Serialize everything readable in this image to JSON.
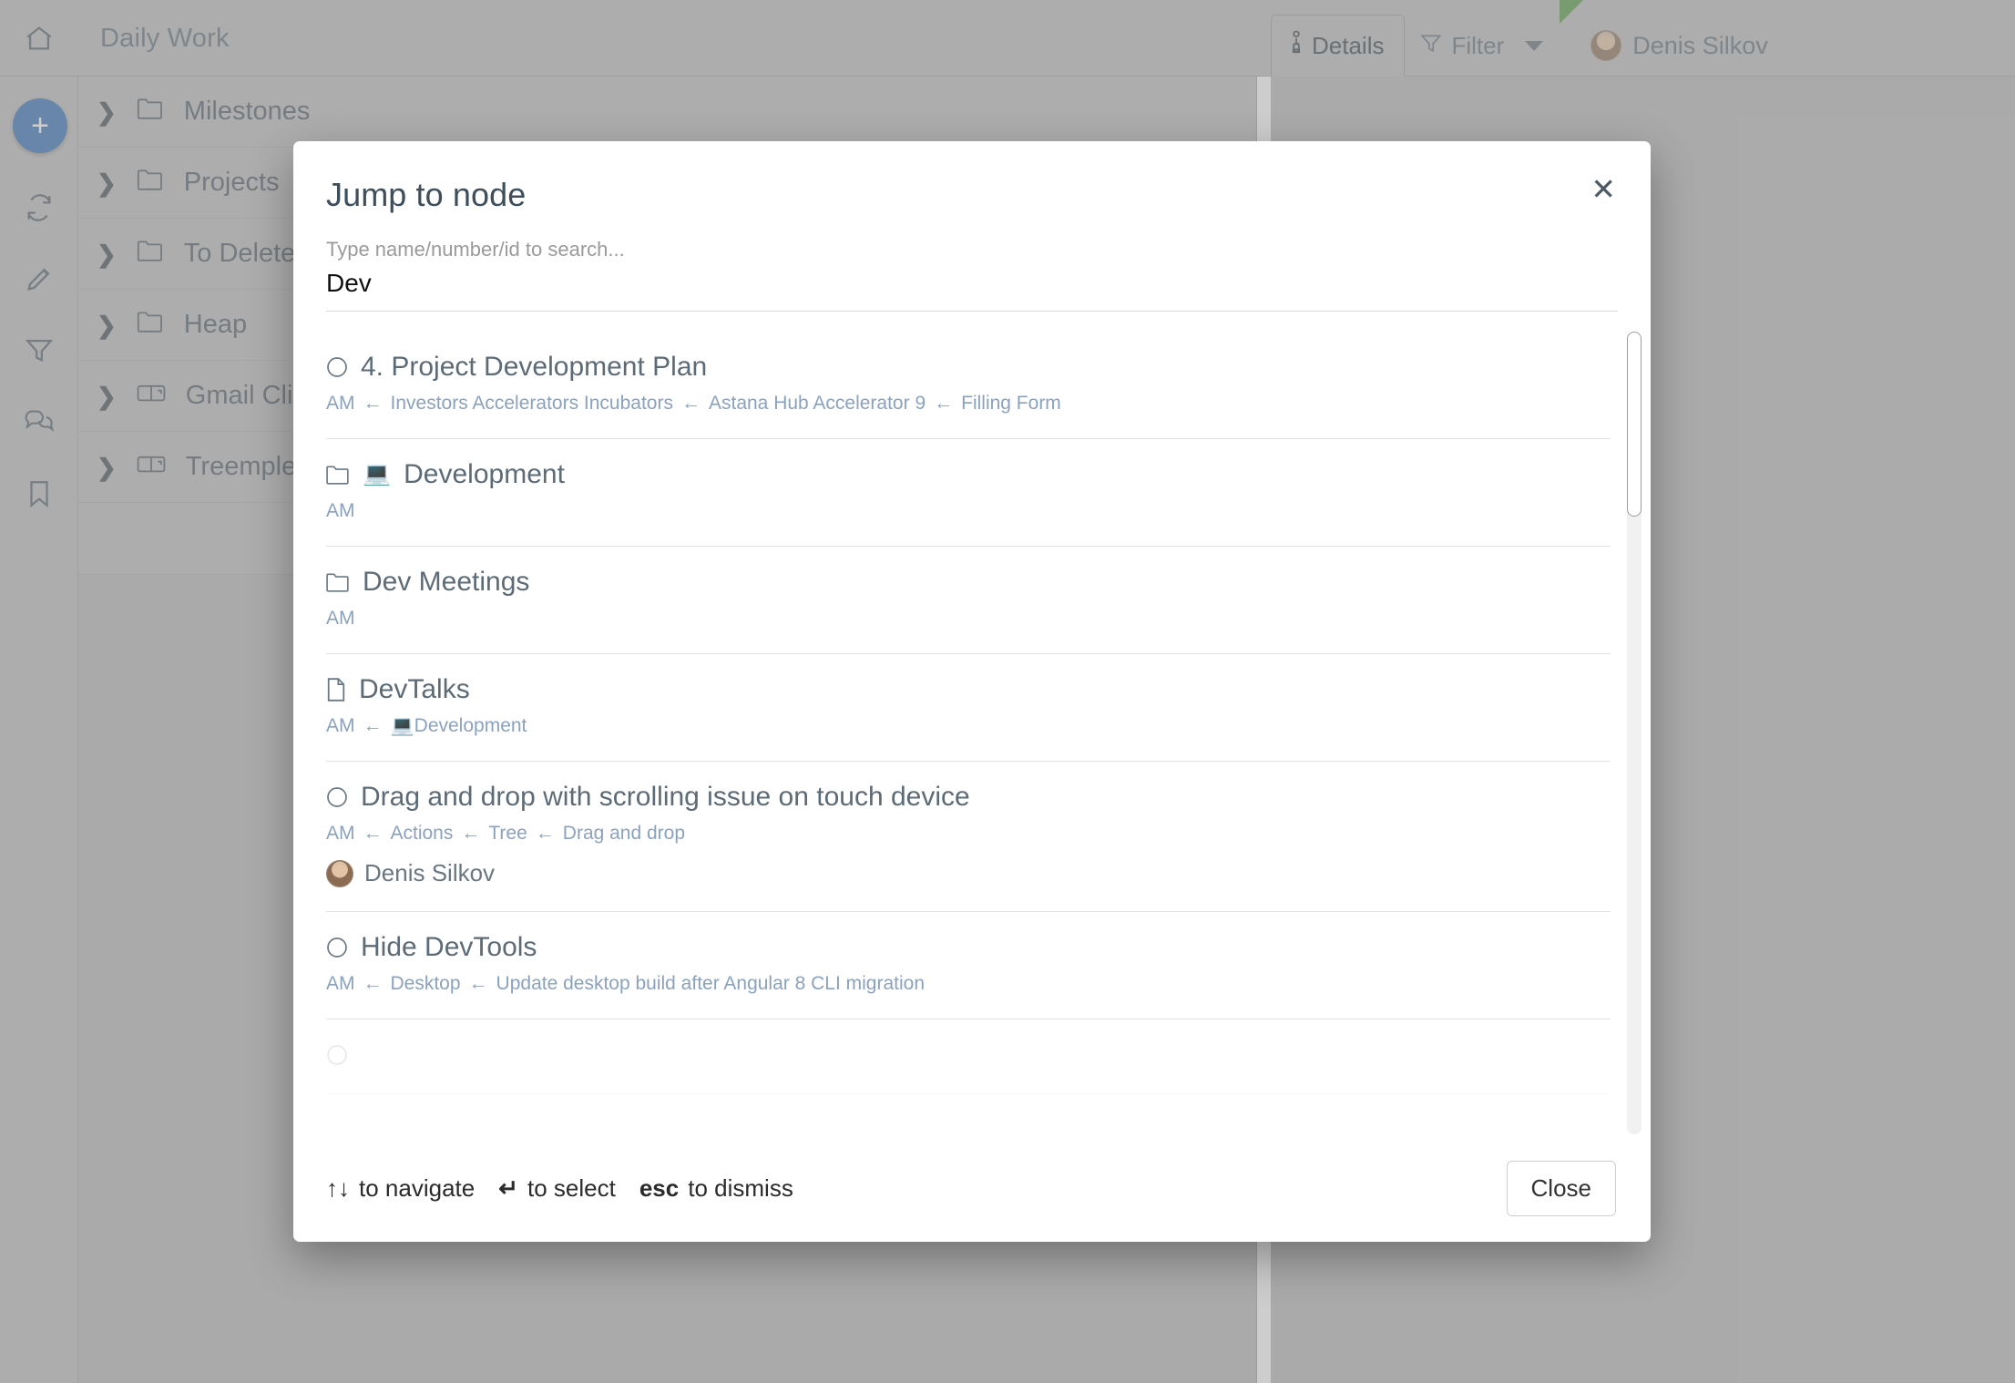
{
  "header": {
    "home_icon": "home-icon",
    "doc_title": "Daily Work",
    "details_tab": "Details",
    "details_icon": "info-person-icon",
    "filter_label": "Filter",
    "filter_icon": "funnel-icon",
    "user_name": "Denis Silkov"
  },
  "rail": {
    "add_label": "+",
    "icons": [
      "sync-icon",
      "pencil-icon",
      "funnel-icon",
      "comments-icon",
      "bookmark-icon"
    ]
  },
  "tree": {
    "items": [
      {
        "label": "Milestones",
        "icon": "folder-icon"
      },
      {
        "label": "Projects",
        "icon": "folder-icon"
      },
      {
        "label": "To Delete",
        "icon": "folder-icon"
      },
      {
        "label": "Heap",
        "icon": "folder-icon"
      },
      {
        "label": "Gmail Client",
        "icon": "mailbox-icon"
      },
      {
        "label": "Treemple G",
        "icon": "mailbox-icon"
      }
    ]
  },
  "modal": {
    "title": "Jump to node",
    "close_icon": "close-icon",
    "search_placeholder": "Type name/number/id to search...",
    "search_value": "Dev",
    "results": [
      {
        "icon": "circle-task-icon",
        "emoji": "",
        "title": "4. Project Development Plan",
        "path": [
          "AM",
          "Investors Accelerators Incubators",
          "Astana Hub Accelerator 9",
          "Filling Form"
        ],
        "assignee": ""
      },
      {
        "icon": "folder-icon",
        "emoji": "💻",
        "title": "Development",
        "path": [
          "AM"
        ],
        "assignee": ""
      },
      {
        "icon": "folder-icon",
        "emoji": "",
        "title": "Dev Meetings",
        "path": [
          "AM"
        ],
        "assignee": ""
      },
      {
        "icon": "document-icon",
        "emoji": "",
        "title": "DevTalks",
        "path": [
          "AM",
          "💻Development"
        ],
        "assignee": ""
      },
      {
        "icon": "circle-task-icon",
        "emoji": "",
        "title": "Drag and drop with scrolling issue on touch device",
        "path": [
          "AM",
          "Actions",
          "Tree",
          "Drag and drop"
        ],
        "assignee": "Denis Silkov"
      },
      {
        "icon": "circle-task-icon",
        "emoji": "",
        "title": "Hide DevTools",
        "path": [
          "AM",
          "Desktop",
          "Update desktop build after Angular 8 CLI migration"
        ],
        "assignee": ""
      }
    ],
    "path_arrow": "←",
    "footer": {
      "navigate_keys": "↑↓",
      "navigate_label": "to navigate",
      "select_key": "↵",
      "select_label": "to select",
      "dismiss_key": "esc",
      "dismiss_label": "to dismiss",
      "close_button": "Close"
    }
  },
  "colors": {
    "accent": "#2d6cb5",
    "path_link": "#8ba2bd",
    "text": "#5d6b76",
    "chrome": "#bdbdbd",
    "flag_green": "#4e9a3e"
  }
}
